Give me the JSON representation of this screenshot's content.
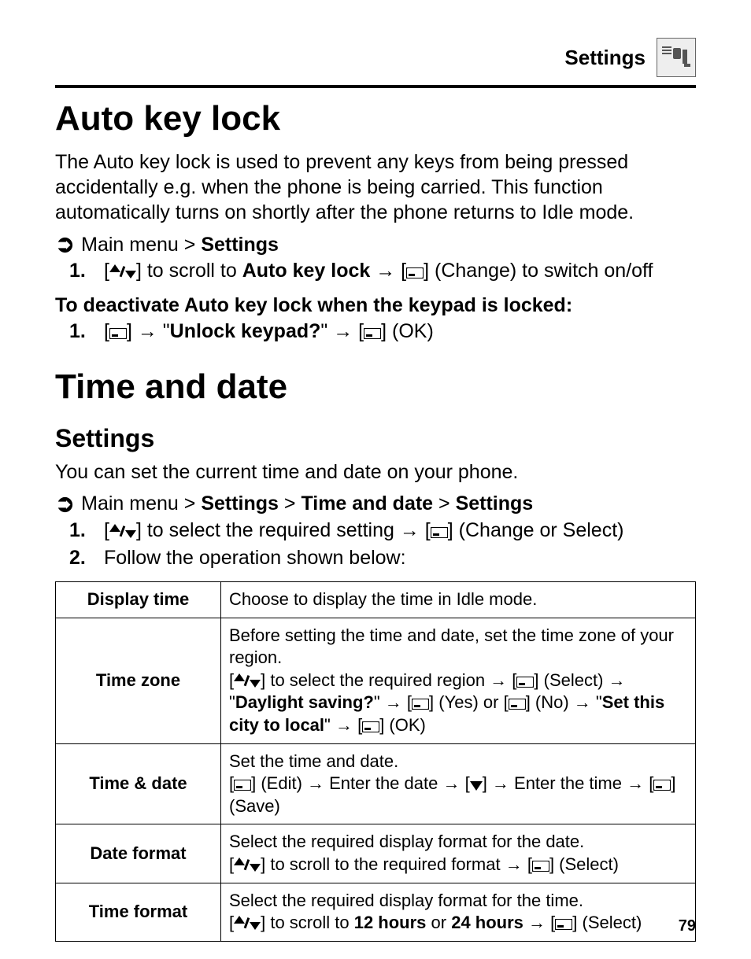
{
  "header": {
    "section": "Settings"
  },
  "section1": {
    "title": "Auto key lock",
    "intro": "The Auto key lock is used to prevent any keys from being pressed accidentally e.g. when the phone is being carried. This function automatically turns on shortly after the phone returns to Idle mode.",
    "nav_prefix": "Main menu > ",
    "nav_bold": "Settings",
    "step1_pre": "[",
    "step1_mid": "] to scroll to ",
    "step1_bold": "Auto key lock",
    "step1_arrow": " → [",
    "step1_after": "] (Change) to switch on/off",
    "deact_heading": "To deactivate Auto key lock when the keypad is locked:",
    "deact_step_pre": "[",
    "deact_step_mid1": "] → \"",
    "deact_step_bold": "Unlock keypad?",
    "deact_step_mid2": "\" → [",
    "deact_step_end": "] (OK)"
  },
  "section2": {
    "title": "Time and date",
    "subtitle": "Settings",
    "intro": "You can set the current time and date on your phone.",
    "nav_prefix": "Main menu > ",
    "nav_b1": "Settings",
    "nav_sep": " > ",
    "nav_b2": "Time and date",
    "nav_b3": "Settings",
    "step1_pre": "[",
    "step1_mid": "] to select the required setting → [",
    "step1_end": "] (Change or Select)",
    "step2": "Follow the operation shown below:"
  },
  "table": {
    "rows": [
      {
        "label": "Display time",
        "desc_plain": "Choose to display the time in Idle mode."
      },
      {
        "label": "Time zone",
        "line1": "Before setting the time and date, set the time zone of your region.",
        "line2_pre": "[",
        "line2_mid1": "] to select the required region → [",
        "line2_mid2": "] (Select) → \"",
        "line2_b1": "Daylight saving?",
        "line2_mid3": "\" → [",
        "line2_mid4": "] (Yes) or [",
        "line2_mid5": "] (No) → \"",
        "line2_b2": "Set this city to local",
        "line2_mid6": "\" → [",
        "line2_end": "] (OK)"
      },
      {
        "label": "Time & date",
        "line1": "Set the time and date.",
        "line2_pre": "[",
        "line2_mid1": "] (Edit) → Enter the date → [",
        "line2_mid2": "] → Enter the time → [",
        "line2_end": "] (Save)"
      },
      {
        "label": "Date format",
        "line1": "Select the required display format for the date.",
        "line2_pre": "[",
        "line2_mid1": "] to scroll to the required format → [",
        "line2_end": "] (Select)"
      },
      {
        "label": "Time format",
        "line1": "Select the required display format for the time.",
        "line2_pre": "[",
        "line2_mid1": "] to scroll to ",
        "line2_b1": "12 hours",
        "line2_or": " or ",
        "line2_b2": "24 hours",
        "line2_mid2": " → [",
        "line2_end": "] (Select)"
      }
    ]
  },
  "page": "79"
}
